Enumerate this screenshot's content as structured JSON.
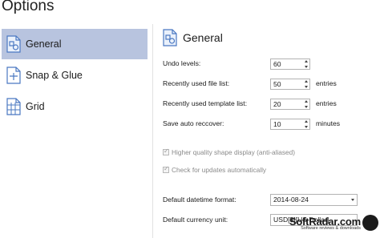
{
  "window": {
    "title": "Options"
  },
  "sidebar": {
    "items": [
      {
        "label": "General",
        "icon": "general-icon",
        "active": true
      },
      {
        "label": "Snap & Glue",
        "icon": "snap-glue-icon",
        "active": false
      },
      {
        "label": "Grid",
        "icon": "grid-icon",
        "active": false
      }
    ]
  },
  "panel": {
    "title": "General",
    "undo": {
      "label": "Undo levels:",
      "value": "60"
    },
    "recent_files": {
      "label": "Recently used file list:",
      "value": "50",
      "unit": "entries"
    },
    "recent_templates": {
      "label": "Recently used template list:",
      "value": "20",
      "unit": "entries"
    },
    "autosave": {
      "label": "Save auto reccover:",
      "value": "10",
      "unit": "minutes"
    },
    "hq_shape": {
      "label": "Higher quality shape display (anti-aliased)",
      "checked": true
    },
    "updates": {
      "label": "Check for updates automatically",
      "checked": true
    },
    "datetime": {
      "label": "Default datetime format:",
      "value": "2014-08-24"
    },
    "currency": {
      "label": "Default currency unit:",
      "value": "USD[$][US Dollar]"
    }
  },
  "watermark": {
    "main": "SoftRadar.com",
    "sub": "Software reviews & downloads"
  },
  "colors": {
    "active_bg": "#b8c4df",
    "icon_blue": "#4a78c2"
  }
}
